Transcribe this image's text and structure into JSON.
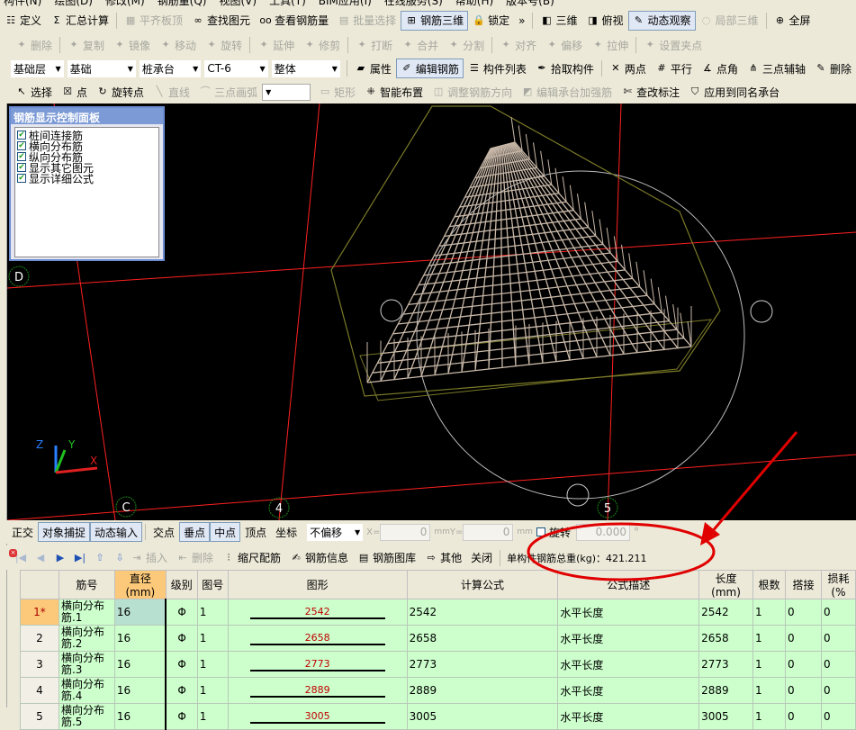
{
  "menu": [
    "构件(N)",
    "绘图(D)",
    "修改(M)",
    "钢筋量(Q)",
    "视图(V)",
    "工具(T)",
    "BIM应用(I)",
    "在线服务(S)",
    "帮助(H)",
    "版本号(B)"
  ],
  "toolbar1": [
    {
      "icon": "define-icon",
      "label": "定义"
    },
    {
      "icon": "sigma-icon",
      "label": "汇总计算"
    },
    {
      "icon": "align-slab-icon",
      "label": "平齐板顶",
      "disabled": true
    },
    {
      "icon": "binoculars-icon",
      "label": "查找图元"
    },
    {
      "icon": "glasses-icon",
      "label": "查看钢筋量"
    },
    {
      "icon": "batch-select-icon",
      "label": "批量选择",
      "disabled": true
    },
    {
      "icon": "rebar-3d-icon",
      "label": "钢筋三维",
      "active": true
    },
    {
      "icon": "lock-icon",
      "label": "锁定"
    },
    {
      "icon": "more-icon",
      "label": "»"
    },
    {
      "icon": "cube-icon",
      "label": "三维"
    },
    {
      "icon": "top-view-icon",
      "label": "俯视"
    },
    {
      "icon": "orbit-icon",
      "label": "动态观察",
      "active": true
    },
    {
      "icon": "partial-3d-icon",
      "label": "局部三维",
      "disabled": true
    },
    {
      "icon": "fullscreen-icon",
      "label": "全屏"
    }
  ],
  "toolbar2": [
    "删除",
    "复制",
    "镜像",
    "移动",
    "旋转",
    "延伸",
    "修剪",
    "打断",
    "合并",
    "分割",
    "对齐",
    "偏移",
    "拉伸",
    "设置夹点"
  ],
  "toolbar3": {
    "combos": [
      "基础层",
      "基础",
      "桩承台",
      "CT-6",
      "整体"
    ],
    "buttons": [
      {
        "icon": "property-icon",
        "label": "属性"
      },
      {
        "icon": "edit-rebar-icon",
        "label": "编辑钢筋",
        "active": true
      },
      {
        "icon": "list-icon",
        "label": "构件列表"
      },
      {
        "icon": "pick-icon",
        "label": "拾取构件"
      },
      {
        "icon": "two-point-axis-icon",
        "label": "两点"
      },
      {
        "icon": "parallel-icon",
        "label": "平行"
      },
      {
        "icon": "point-angle-icon",
        "label": "点角"
      },
      {
        "icon": "three-point-axis-icon",
        "label": "三点辅轴"
      },
      {
        "icon": "delete-icon",
        "label": "删除"
      }
    ]
  },
  "toolbar4": [
    {
      "icon": "cursor-icon",
      "label": "选择",
      "disabled": false
    },
    {
      "icon": "point-icon",
      "label": "点",
      "disabled": false
    },
    {
      "icon": "rotate-point-icon",
      "label": "旋转点",
      "disabled": false
    },
    {
      "icon": "line-icon",
      "label": "直线",
      "disabled": true
    },
    {
      "icon": "arc-icon",
      "label": "三点画弧",
      "disabled": true
    },
    {
      "icon": "rect-icon",
      "label": "矩形",
      "disabled": true
    },
    {
      "icon": "smart-layout-icon",
      "label": "智能布置",
      "disabled": false
    },
    {
      "icon": "adjust-dir-icon",
      "label": "调整钢筋方向",
      "disabled": true
    },
    {
      "icon": "edit-cap-icon",
      "label": "编辑承台加强筋",
      "disabled": true
    },
    {
      "icon": "edit-label-icon",
      "label": "查改标注",
      "disabled": false
    },
    {
      "icon": "apply-same-icon",
      "label": "应用到同名承台",
      "disabled": false
    }
  ],
  "panel": {
    "title": "钢筋显示控制面板",
    "items": [
      {
        "label": "桩间连接筋",
        "checked": true
      },
      {
        "label": "横向分布筋",
        "checked": true
      },
      {
        "label": "纵向分布筋",
        "checked": true
      },
      {
        "label": "显示其它图元",
        "checked": true
      },
      {
        "label": "显示详细公式",
        "checked": true
      }
    ]
  },
  "viewport": {
    "axis_labels": [
      "D",
      "C",
      "4",
      "5"
    ],
    "coord_axes": [
      "Z",
      "Y",
      "X"
    ]
  },
  "snapbar": {
    "buttons": [
      {
        "label": "正交"
      },
      {
        "label": "对象捕捉",
        "active": true
      },
      {
        "label": "动态输入",
        "active": true
      },
      {
        "label": "交点"
      },
      {
        "label": "垂点",
        "active": true
      },
      {
        "label": "中点",
        "active": true
      },
      {
        "label": "顶点"
      },
      {
        "label": "坐标"
      }
    ],
    "offset_mode": "不偏移",
    "x_label": "X=",
    "x_value": "0",
    "y_label": "Y=",
    "y_value": "0",
    "unit": "mm",
    "rotate_label": "旋转",
    "rotate_value": "0.000",
    "degree": "°"
  },
  "table_toolbar": {
    "buttons": [
      "插入",
      "删除",
      "缩尺配筋",
      "钢筋信息",
      "钢筋图库",
      "其他",
      "关闭"
    ],
    "total_label": "单构件钢筋总重(kg)：421.211"
  },
  "table": {
    "headers": [
      "",
      "筋号",
      "直径(mm)",
      "级别",
      "图号",
      "图形",
      "计算公式",
      "公式描述",
      "长度(mm)",
      "根数",
      "搭接",
      "损耗(%"
    ],
    "rows": [
      [
        "1*",
        "横向分布筋.1",
        "16",
        "Φ",
        "1",
        "2542",
        "2542",
        "水平长度",
        "2542",
        "1",
        "0",
        "0"
      ],
      [
        "2",
        "横向分布筋.2",
        "16",
        "Φ",
        "1",
        "2658",
        "2658",
        "水平长度",
        "2658",
        "1",
        "0",
        "0"
      ],
      [
        "3",
        "横向分布筋.3",
        "16",
        "Φ",
        "1",
        "2773",
        "2773",
        "水平长度",
        "2773",
        "1",
        "0",
        "0"
      ],
      [
        "4",
        "横向分布筋.4",
        "16",
        "Φ",
        "1",
        "2889",
        "2889",
        "水平长度",
        "2889",
        "1",
        "0",
        "0"
      ],
      [
        "5",
        "横向分布筋.5",
        "16",
        "Φ",
        "1",
        "3005",
        "3005",
        "水平长度",
        "3005",
        "1",
        "0",
        "0"
      ]
    ]
  },
  "colors": {
    "viewport_bg": "#000000",
    "axis_line": "#ff2020",
    "rebar": "#c8b8a8",
    "annotation": "#e00000",
    "panel_title": "#7b9ad6",
    "table_row": "#ccffcc"
  }
}
